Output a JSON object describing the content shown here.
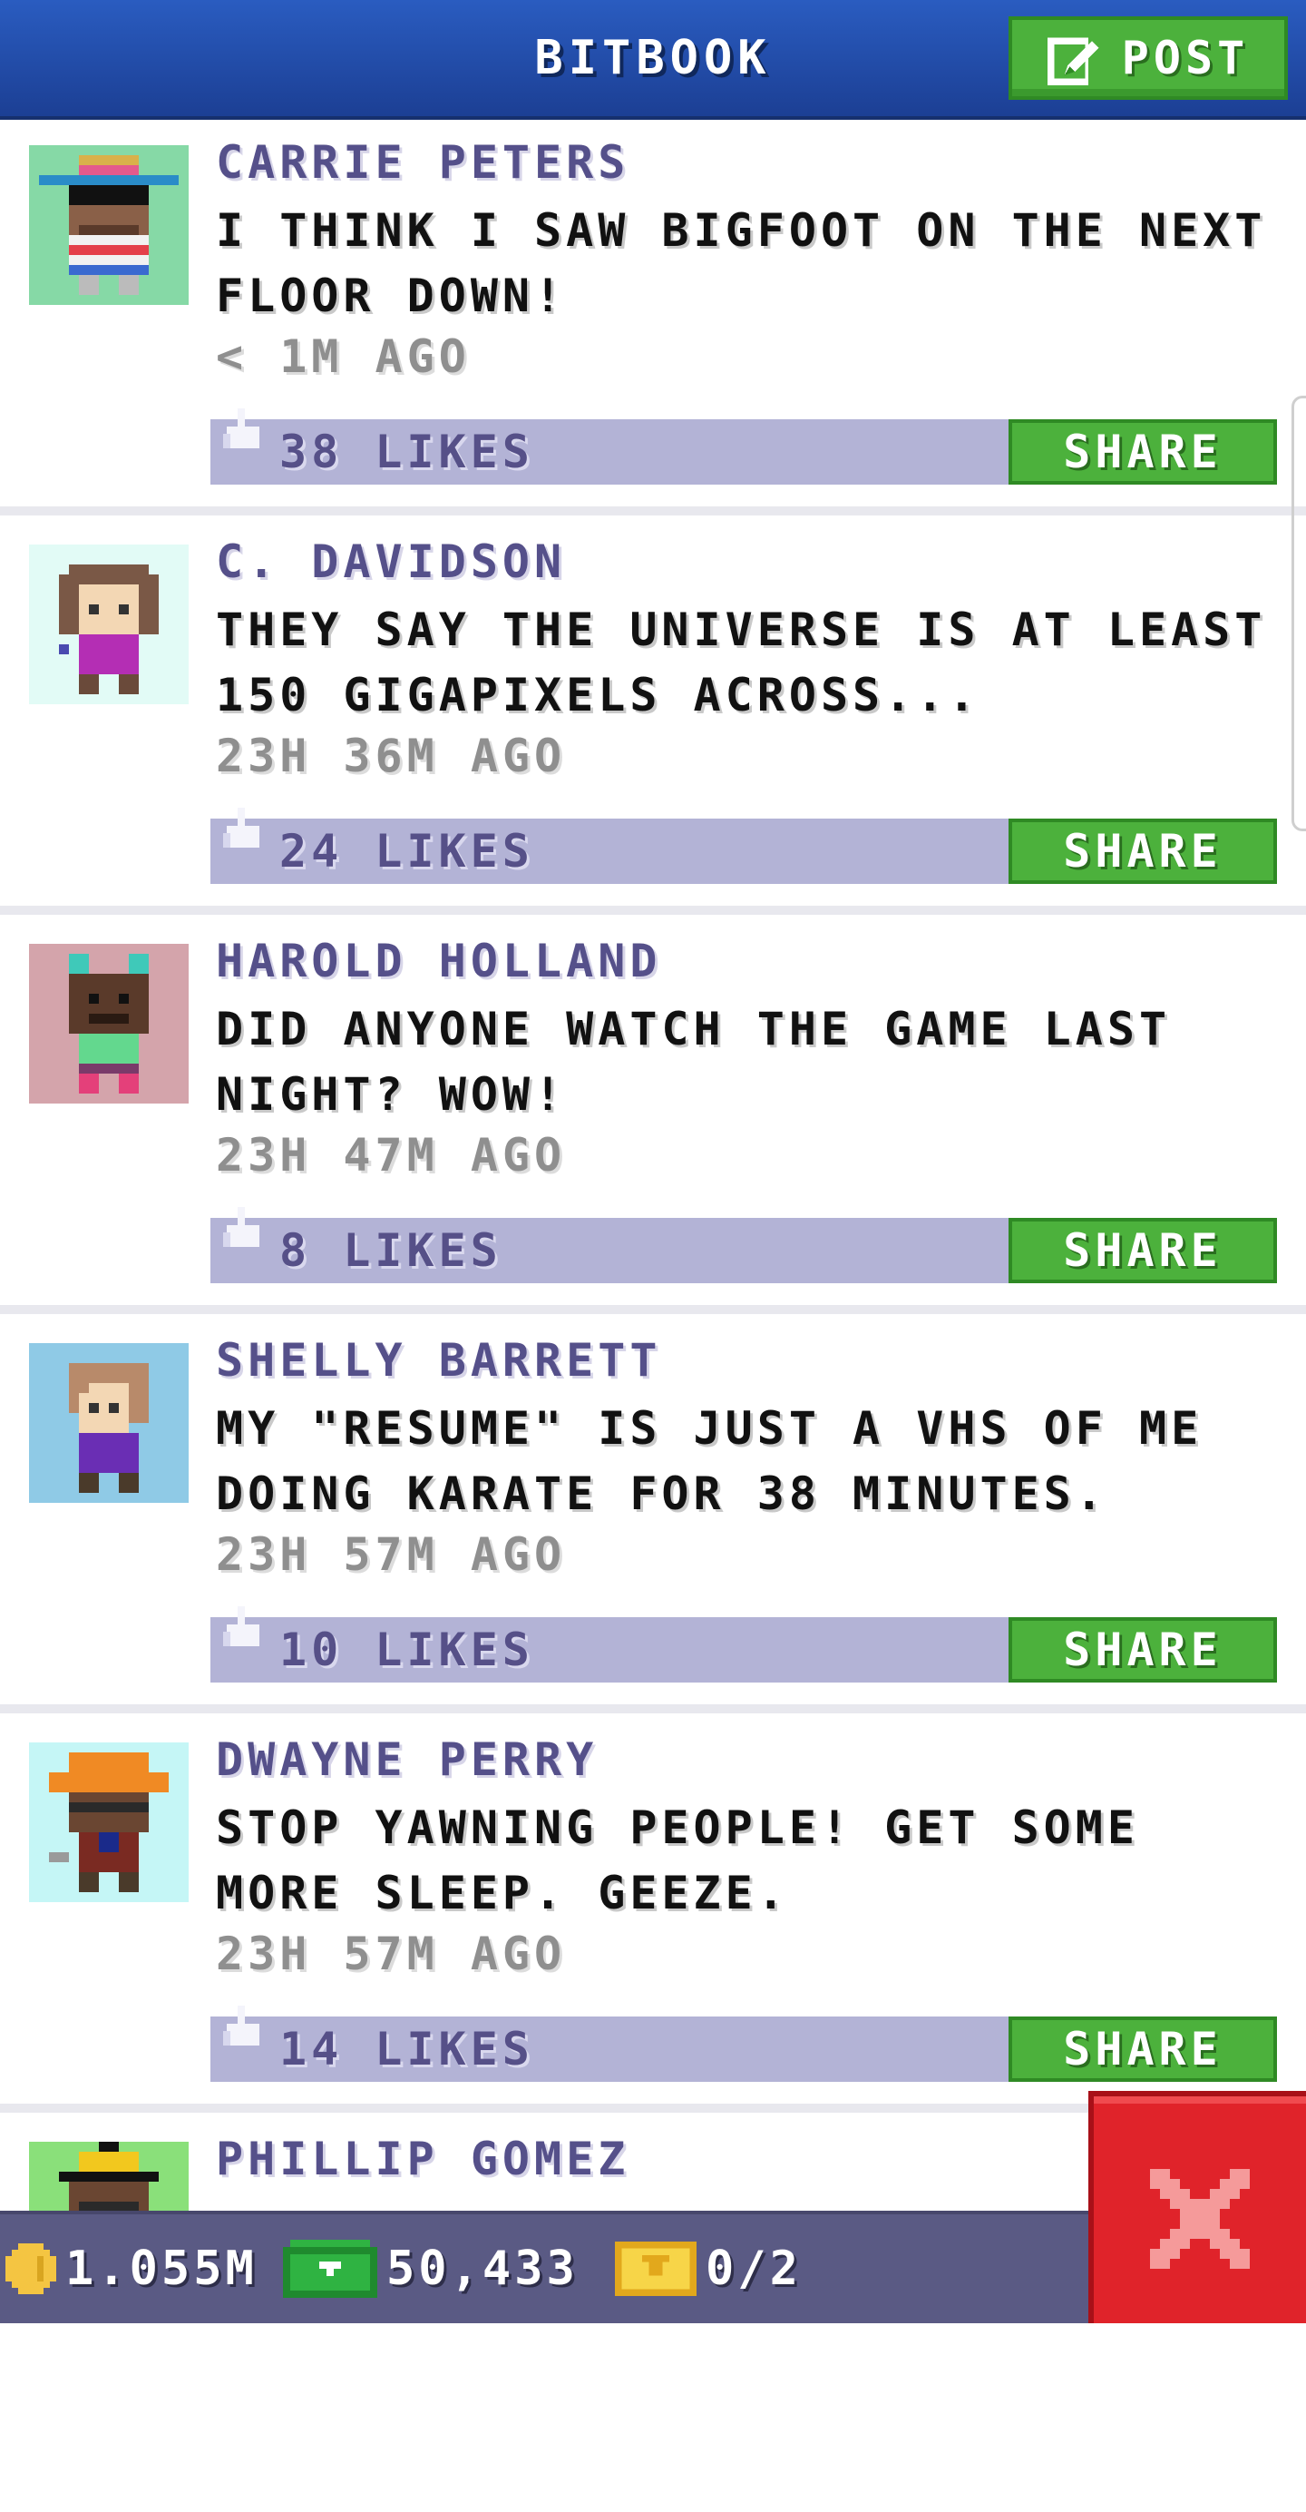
{
  "header": {
    "title": "BITBOOK",
    "post_label": "POST"
  },
  "posts": [
    {
      "author": "CARRIE PETERS",
      "message": "I THINK I SAW BIGFOOT ON THE NEXT FLOOR DOWN!",
      "time": "< 1M AGO",
      "likes": "38 LIKES",
      "share_label": "SHARE",
      "avatar_bg": "#86d9a6"
    },
    {
      "author": "C. DAVIDSON",
      "message": "THEY SAY THE UNIVERSE IS AT LEAST 150 GIGAPIXELS ACROSS...",
      "time": "23H 36M AGO",
      "likes": "24 LIKES",
      "share_label": "SHARE",
      "avatar_bg": "#e2fbf6"
    },
    {
      "author": "HAROLD HOLLAND",
      "message": "DID ANYONE WATCH THE GAME LAST NIGHT? WOW!",
      "time": "23H 47M AGO",
      "likes": "8 LIKES",
      "share_label": "SHARE",
      "avatar_bg": "#d4a4ab"
    },
    {
      "author": "SHELLY BARRETT",
      "message": "MY \"RESUME\" IS JUST A VHS OF ME DOING KARATE FOR 38 MINUTES.",
      "time": "23H 57M AGO",
      "likes": "10 LIKES",
      "share_label": "SHARE",
      "avatar_bg": "#8fcae6"
    },
    {
      "author": "DWAYNE PERRY",
      "message": "STOP YAWNING PEOPLE! GET SOME MORE SLEEP. GEEZE.",
      "time": "23H 57M AGO",
      "likes": "14 LIKES",
      "share_label": "SHARE",
      "avatar_bg": "#c5f6f6"
    },
    {
      "author": "PHILLIP GOMEZ",
      "message": "",
      "time": "",
      "likes": "",
      "share_label": "",
      "avatar_bg": "#8ae07a"
    }
  ],
  "status_bar": {
    "coins": "1.055M",
    "bux": "50,433",
    "tickets": "0/2"
  },
  "icons": {
    "post": "edit-icon",
    "like": "thumbs-up-icon",
    "coins": "coin-icon",
    "bux": "bux-icon",
    "tickets": "ticket-icon",
    "close": "close-icon"
  },
  "colors": {
    "header": "#1f4aa8",
    "accent_green": "#4cb13c",
    "likes_bar": "#b3b3d6",
    "author_text": "#55508a",
    "close_red": "#e0232a",
    "status_bar": "#5a5a84"
  }
}
